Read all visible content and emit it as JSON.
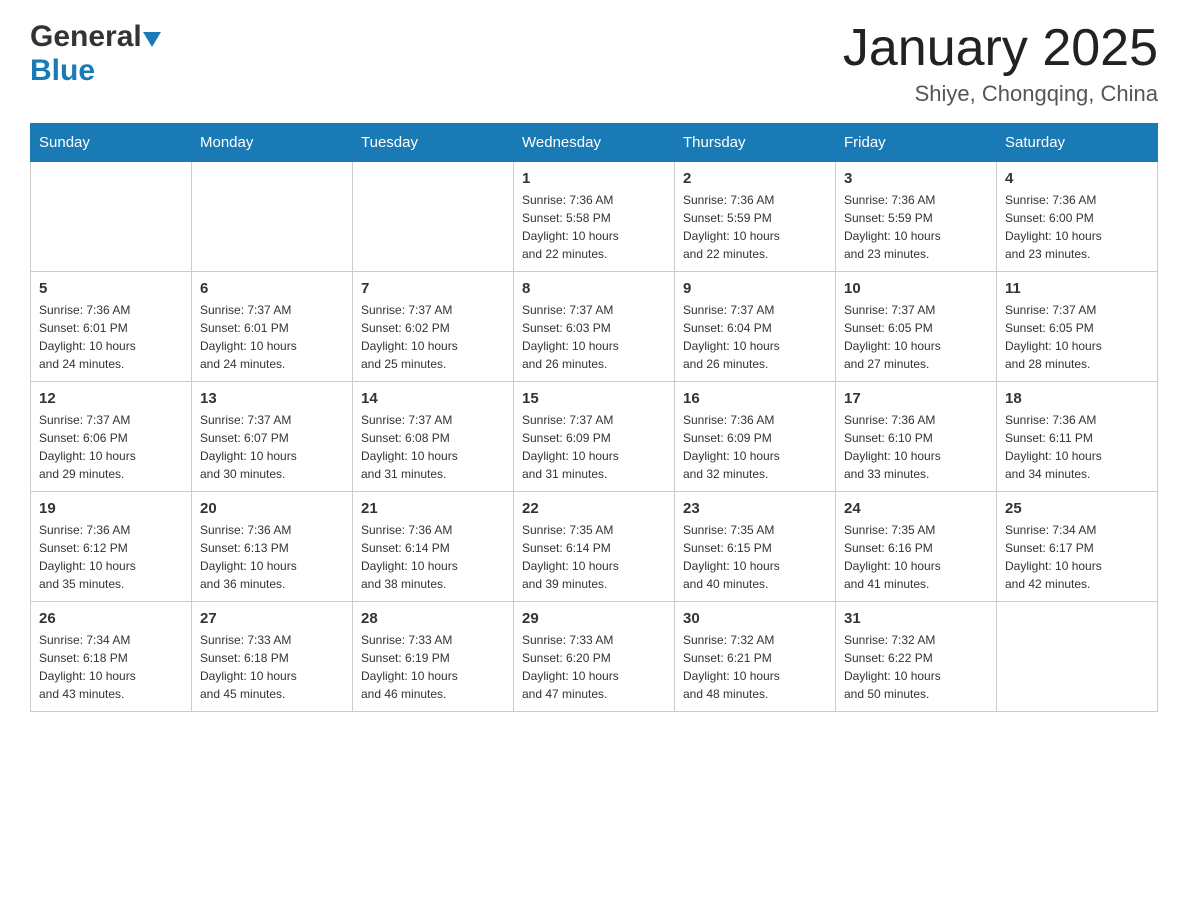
{
  "header": {
    "logo_general": "General",
    "logo_blue": "Blue",
    "month_title": "January 2025",
    "location": "Shiye, Chongqing, China"
  },
  "days_of_week": [
    "Sunday",
    "Monday",
    "Tuesday",
    "Wednesday",
    "Thursday",
    "Friday",
    "Saturday"
  ],
  "weeks": [
    [
      {
        "day": "",
        "info": ""
      },
      {
        "day": "",
        "info": ""
      },
      {
        "day": "",
        "info": ""
      },
      {
        "day": "1",
        "info": "Sunrise: 7:36 AM\nSunset: 5:58 PM\nDaylight: 10 hours\nand 22 minutes."
      },
      {
        "day": "2",
        "info": "Sunrise: 7:36 AM\nSunset: 5:59 PM\nDaylight: 10 hours\nand 22 minutes."
      },
      {
        "day": "3",
        "info": "Sunrise: 7:36 AM\nSunset: 5:59 PM\nDaylight: 10 hours\nand 23 minutes."
      },
      {
        "day": "4",
        "info": "Sunrise: 7:36 AM\nSunset: 6:00 PM\nDaylight: 10 hours\nand 23 minutes."
      }
    ],
    [
      {
        "day": "5",
        "info": "Sunrise: 7:36 AM\nSunset: 6:01 PM\nDaylight: 10 hours\nand 24 minutes."
      },
      {
        "day": "6",
        "info": "Sunrise: 7:37 AM\nSunset: 6:01 PM\nDaylight: 10 hours\nand 24 minutes."
      },
      {
        "day": "7",
        "info": "Sunrise: 7:37 AM\nSunset: 6:02 PM\nDaylight: 10 hours\nand 25 minutes."
      },
      {
        "day": "8",
        "info": "Sunrise: 7:37 AM\nSunset: 6:03 PM\nDaylight: 10 hours\nand 26 minutes."
      },
      {
        "day": "9",
        "info": "Sunrise: 7:37 AM\nSunset: 6:04 PM\nDaylight: 10 hours\nand 26 minutes."
      },
      {
        "day": "10",
        "info": "Sunrise: 7:37 AM\nSunset: 6:05 PM\nDaylight: 10 hours\nand 27 minutes."
      },
      {
        "day": "11",
        "info": "Sunrise: 7:37 AM\nSunset: 6:05 PM\nDaylight: 10 hours\nand 28 minutes."
      }
    ],
    [
      {
        "day": "12",
        "info": "Sunrise: 7:37 AM\nSunset: 6:06 PM\nDaylight: 10 hours\nand 29 minutes."
      },
      {
        "day": "13",
        "info": "Sunrise: 7:37 AM\nSunset: 6:07 PM\nDaylight: 10 hours\nand 30 minutes."
      },
      {
        "day": "14",
        "info": "Sunrise: 7:37 AM\nSunset: 6:08 PM\nDaylight: 10 hours\nand 31 minutes."
      },
      {
        "day": "15",
        "info": "Sunrise: 7:37 AM\nSunset: 6:09 PM\nDaylight: 10 hours\nand 31 minutes."
      },
      {
        "day": "16",
        "info": "Sunrise: 7:36 AM\nSunset: 6:09 PM\nDaylight: 10 hours\nand 32 minutes."
      },
      {
        "day": "17",
        "info": "Sunrise: 7:36 AM\nSunset: 6:10 PM\nDaylight: 10 hours\nand 33 minutes."
      },
      {
        "day": "18",
        "info": "Sunrise: 7:36 AM\nSunset: 6:11 PM\nDaylight: 10 hours\nand 34 minutes."
      }
    ],
    [
      {
        "day": "19",
        "info": "Sunrise: 7:36 AM\nSunset: 6:12 PM\nDaylight: 10 hours\nand 35 minutes."
      },
      {
        "day": "20",
        "info": "Sunrise: 7:36 AM\nSunset: 6:13 PM\nDaylight: 10 hours\nand 36 minutes."
      },
      {
        "day": "21",
        "info": "Sunrise: 7:36 AM\nSunset: 6:14 PM\nDaylight: 10 hours\nand 38 minutes."
      },
      {
        "day": "22",
        "info": "Sunrise: 7:35 AM\nSunset: 6:14 PM\nDaylight: 10 hours\nand 39 minutes."
      },
      {
        "day": "23",
        "info": "Sunrise: 7:35 AM\nSunset: 6:15 PM\nDaylight: 10 hours\nand 40 minutes."
      },
      {
        "day": "24",
        "info": "Sunrise: 7:35 AM\nSunset: 6:16 PM\nDaylight: 10 hours\nand 41 minutes."
      },
      {
        "day": "25",
        "info": "Sunrise: 7:34 AM\nSunset: 6:17 PM\nDaylight: 10 hours\nand 42 minutes."
      }
    ],
    [
      {
        "day": "26",
        "info": "Sunrise: 7:34 AM\nSunset: 6:18 PM\nDaylight: 10 hours\nand 43 minutes."
      },
      {
        "day": "27",
        "info": "Sunrise: 7:33 AM\nSunset: 6:18 PM\nDaylight: 10 hours\nand 45 minutes."
      },
      {
        "day": "28",
        "info": "Sunrise: 7:33 AM\nSunset: 6:19 PM\nDaylight: 10 hours\nand 46 minutes."
      },
      {
        "day": "29",
        "info": "Sunrise: 7:33 AM\nSunset: 6:20 PM\nDaylight: 10 hours\nand 47 minutes."
      },
      {
        "day": "30",
        "info": "Sunrise: 7:32 AM\nSunset: 6:21 PM\nDaylight: 10 hours\nand 48 minutes."
      },
      {
        "day": "31",
        "info": "Sunrise: 7:32 AM\nSunset: 6:22 PM\nDaylight: 10 hours\nand 50 minutes."
      },
      {
        "day": "",
        "info": ""
      }
    ]
  ]
}
